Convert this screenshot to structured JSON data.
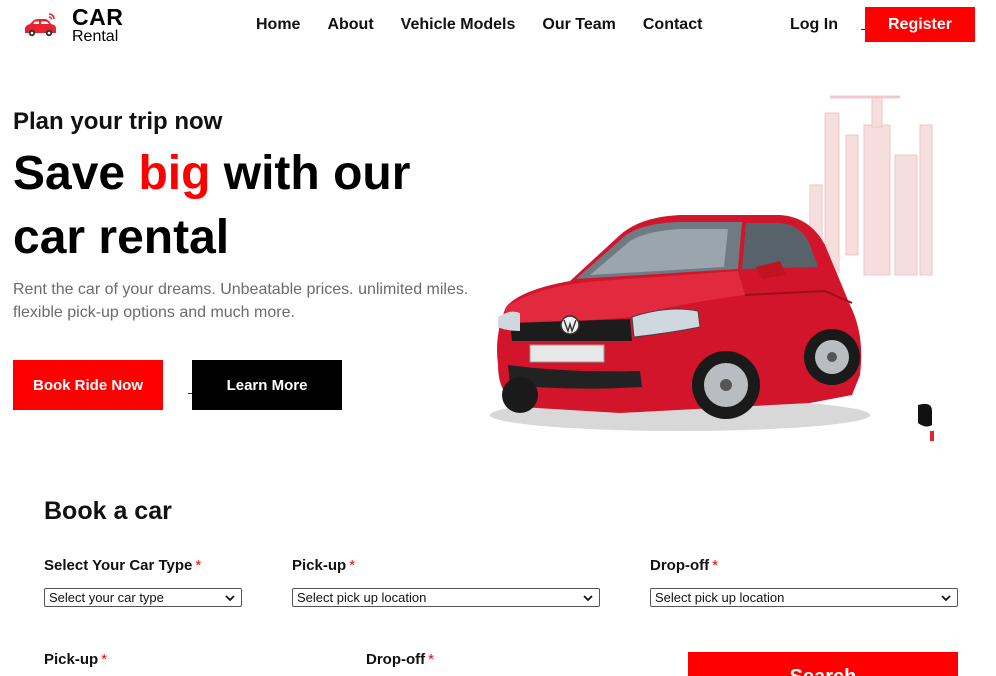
{
  "brand": {
    "title": "CAR",
    "subtitle": "Rental",
    "icon": "car-icon",
    "color": "#e8232f"
  },
  "nav": {
    "items": [
      {
        "label": "Home"
      },
      {
        "label": "About"
      },
      {
        "label": "Vehicle Models"
      },
      {
        "label": "Our Team"
      },
      {
        "label": "Contact"
      }
    ]
  },
  "auth": {
    "login_label": "Log In",
    "register_label": "Register"
  },
  "hero": {
    "eyebrow": "Plan your trip now",
    "title_prefix": "Save ",
    "title_highlight": "big",
    "title_suffix": " with our car rental",
    "description": "Rent the car of your dreams. Unbeatable prices. unlimited miles. flexible pick-up options and much more.",
    "book_button": "Book Ride Now",
    "learn_button": "Learn More",
    "image": "red-hatchback-car-with-city-skyline"
  },
  "booking": {
    "title": "Book a car",
    "car_type": {
      "label": "Select Your Car Type",
      "value": "Select your car type"
    },
    "pickup_location": {
      "label": "Pick-up",
      "value": "Select pick up location"
    },
    "dropoff_location": {
      "label": "Drop-off",
      "value": "Select pick up location"
    },
    "pickup_date": {
      "label": "Pick-up"
    },
    "dropoff_date": {
      "label": "Drop-off"
    },
    "required_mark": "*",
    "search_button": "Search"
  },
  "colors": {
    "accent": "#ff0000",
    "dark": "#000000",
    "muted_text": "#6b6b6b"
  }
}
